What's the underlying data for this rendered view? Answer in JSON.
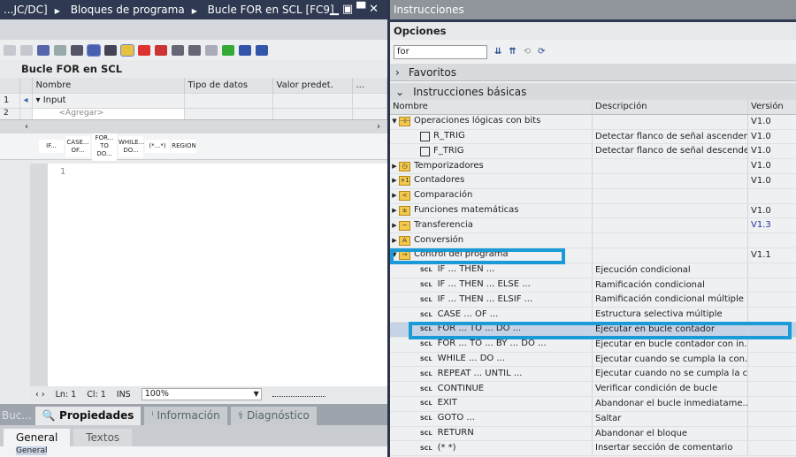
{
  "left": {
    "breadcrumb": [
      "...JC/DC]",
      "Bloques de programa",
      "Bucle FOR en SCL [FC9]"
    ],
    "block_title": "Bucle FOR en SCL",
    "table": {
      "headers": [
        "Nombre",
        "Tipo de datos",
        "Valor predet.",
        "..."
      ],
      "rows": [
        {
          "num": "1",
          "name": "Input"
        },
        {
          "num": "2",
          "name": "<Agregar>"
        }
      ]
    },
    "snippets": [
      "IF...",
      "CASE... OF...",
      "FOR... TO DO...",
      "WHILE... DO...",
      "(*...*)",
      "REGION"
    ],
    "editor": {
      "line": "1"
    },
    "status": {
      "ln": "Ln: 1",
      "cl": "Cl: 1",
      "mode": "INS",
      "zoom": "100%"
    },
    "bottom": {
      "short": "Buc...",
      "tabs": [
        "Propiedades",
        "Información",
        "Diagnóstico"
      ],
      "subtabs": [
        "General",
        "Textos"
      ],
      "nav_item": "General"
    }
  },
  "right": {
    "title": "Instrucciones",
    "options": "Opciones",
    "search_value": "for",
    "favoritos": "Favoritos",
    "basicas": "Instrucciones básicas",
    "headers": [
      "Nombre",
      "Descripción",
      "Versión"
    ],
    "rows": [
      {
        "type": "folder",
        "open": true,
        "icon": "⊣⊢",
        "name": "Operaciones lógicas con bits",
        "desc": "",
        "ver": "V1.0"
      },
      {
        "type": "fb",
        "name": "R_TRIG",
        "desc": "Detectar flanco de señal ascendent",
        "ver": "V1.0"
      },
      {
        "type": "fb",
        "name": "F_TRIG",
        "desc": "Detectar flanco de señal descende.",
        "ver": "V1.0"
      },
      {
        "type": "folder",
        "icon": "◷",
        "name": "Temporizadores",
        "desc": "",
        "ver": "V1.0"
      },
      {
        "type": "folder",
        "icon": "+1",
        "name": "Contadores",
        "desc": "",
        "ver": "V1.0"
      },
      {
        "type": "folder",
        "icon": "<",
        "name": "Comparación",
        "desc": "",
        "ver": ""
      },
      {
        "type": "folder",
        "icon": "±",
        "name": "Funciones matemáticas",
        "desc": "",
        "ver": "V1.0"
      },
      {
        "type": "folder",
        "icon": "~",
        "name": "Transferencia",
        "desc": "",
        "ver": "V1.3",
        "link": true
      },
      {
        "type": "folder",
        "icon": "A",
        "name": "Conversión",
        "desc": "",
        "ver": ""
      },
      {
        "type": "folder",
        "open": true,
        "icon": "→",
        "name": "Control del programa",
        "desc": "",
        "ver": "V1.1"
      },
      {
        "type": "scl",
        "name": "IF ... THEN ...",
        "desc": "Ejecución condicional",
        "ver": ""
      },
      {
        "type": "scl",
        "name": "IF ... THEN ... ELSE ...",
        "desc": "Ramificación condicional",
        "ver": ""
      },
      {
        "type": "scl",
        "name": "IF ... THEN ... ELSIF ...",
        "desc": "Ramificación condicional múltiple",
        "ver": ""
      },
      {
        "type": "scl",
        "name": "CASE ... OF ...",
        "desc": "Estructura selectiva múltiple",
        "ver": ""
      },
      {
        "type": "scl",
        "name": "FOR ... TO ... DO ...",
        "desc": "Ejecutar en bucle contador",
        "ver": "",
        "selected": true
      },
      {
        "type": "scl",
        "name": "FOR ... TO ... BY ... DO ...",
        "desc": "Ejecutar en bucle contador con in...",
        "ver": ""
      },
      {
        "type": "scl",
        "name": "WHILE ... DO ...",
        "desc": "Ejecutar cuando se cumpla la con...",
        "ver": ""
      },
      {
        "type": "scl",
        "name": "REPEAT ... UNTIL ...",
        "desc": "Ejecutar cuando no se cumpla la c...",
        "ver": ""
      },
      {
        "type": "scl",
        "name": "CONTINUE",
        "desc": "Verificar condición de bucle",
        "ver": ""
      },
      {
        "type": "scl",
        "name": "EXIT",
        "desc": "Abandonar el bucle inmediatame...",
        "ver": ""
      },
      {
        "type": "scl",
        "name": "GOTO ...",
        "desc": "Saltar",
        "ver": ""
      },
      {
        "type": "scl",
        "name": "RETURN",
        "desc": "Abandonar el bloque",
        "ver": ""
      },
      {
        "type": "scl",
        "name": "(*  *)",
        "desc": "Insertar sección de comentario",
        "ver": ""
      }
    ],
    "scl_badge": "SCL",
    "highlight_color": "#1a9ad6"
  }
}
